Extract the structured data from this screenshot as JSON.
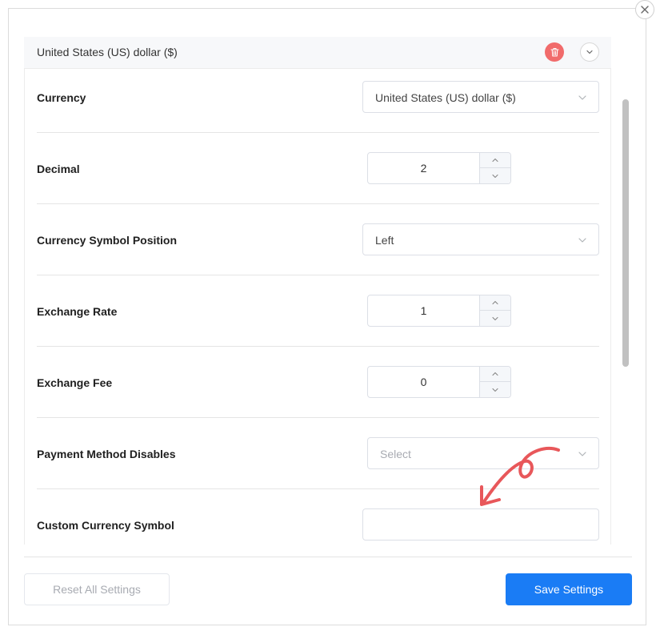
{
  "panel": {
    "title": "United States (US) dollar ($)"
  },
  "fields": {
    "currency": {
      "label": "Currency",
      "value": "United States (US) dollar ($)"
    },
    "decimal": {
      "label": "Decimal",
      "value": "2"
    },
    "symbol_position": {
      "label": "Currency Symbol Position",
      "value": "Left"
    },
    "exchange_rate": {
      "label": "Exchange Rate",
      "value": "1"
    },
    "exchange_fee": {
      "label": "Exchange Fee",
      "value": "0"
    },
    "payment_method_disables": {
      "label": "Payment Method Disables",
      "placeholder": "Select"
    },
    "custom_currency_symbol": {
      "label": "Custom Currency Symbol",
      "value": ""
    }
  },
  "footer": {
    "reset_label": "Reset All Settings",
    "save_label": "Save Settings"
  },
  "icons": {
    "close": "close-icon",
    "delete": "trash-icon",
    "collapse": "chevron-down-icon",
    "select_chevron": "chevron-down-icon",
    "stepper_up": "chevron-up-icon",
    "stepper_down": "chevron-down-icon",
    "annotation": "hand-drawn-arrow-icon"
  },
  "colors": {
    "primary": "#1a7cf5",
    "danger": "#f16b6b",
    "annotation": "#e8575a"
  }
}
